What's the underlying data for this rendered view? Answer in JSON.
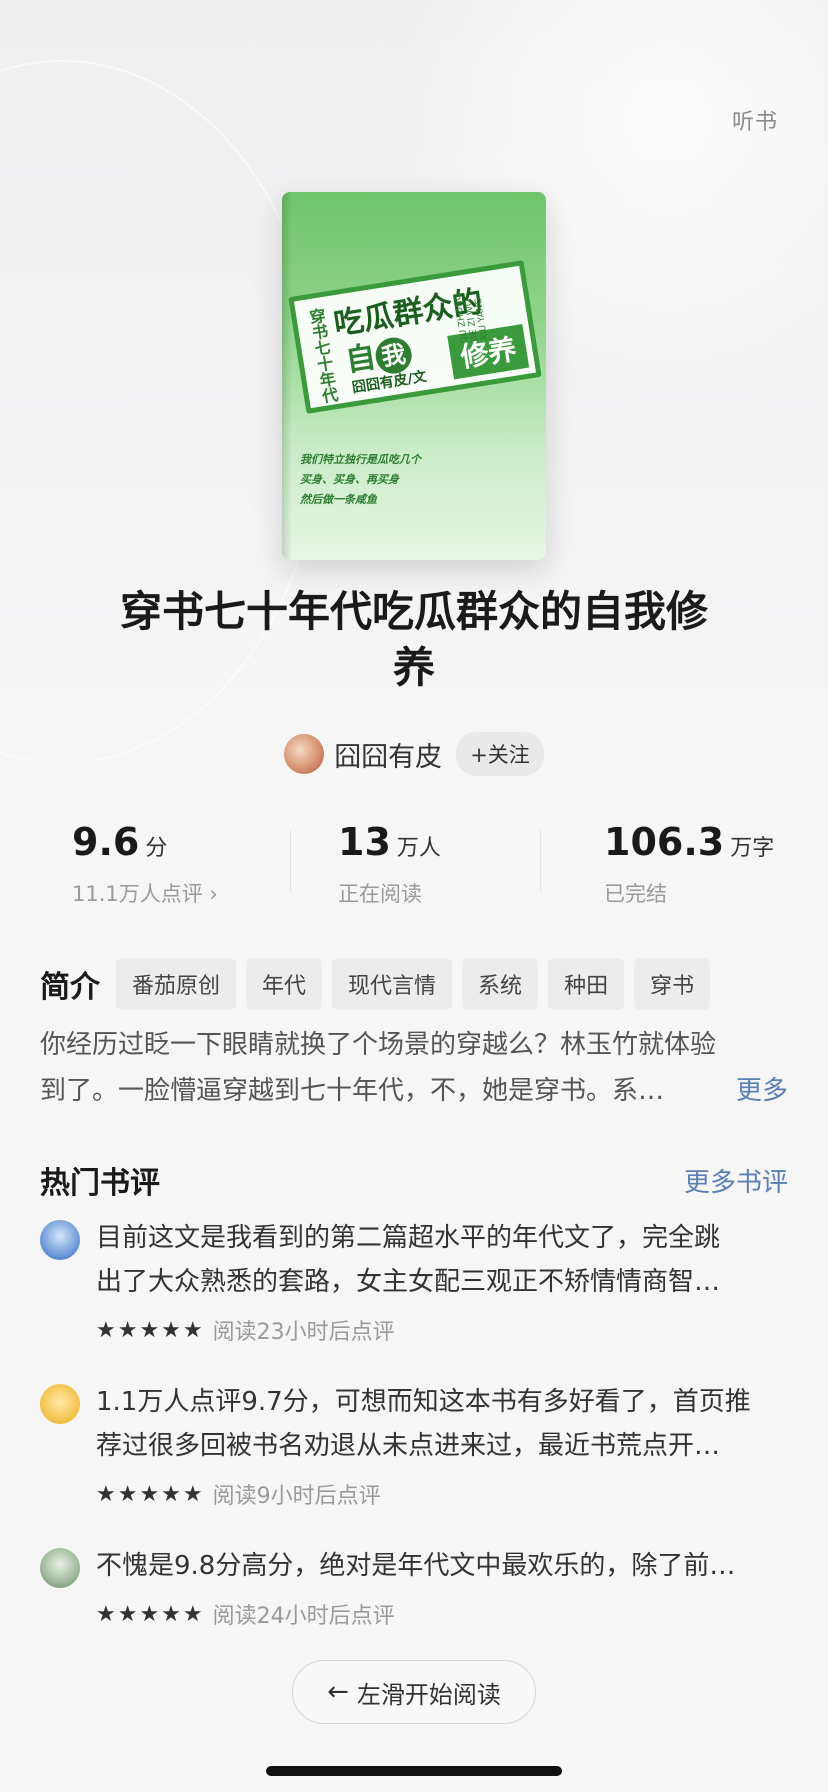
{
  "header": {
    "audio_label": "听书"
  },
  "cover": {
    "side_text": "穿书七十年代",
    "main_line1": "吃瓜群众的",
    "main_line2_a": "自",
    "main_line2_circle": "我",
    "main_line2_box": "修养",
    "author": "囧囧有皮/文",
    "en_text": "QU ZHONG DE ZI WO XIU YANG",
    "slogan": [
      "我们特立独行是瓜吃几个",
      "买身、买身、再买身",
      "然后做一条咸鱼"
    ]
  },
  "book": {
    "title": "穿书七十年代吃瓜群众的自我修养",
    "author": "囧囧有皮",
    "follow_label": "+关注"
  },
  "stats": {
    "rating": {
      "value": "9.6",
      "unit": "分",
      "sub": "11.1万人点评 ›"
    },
    "readers": {
      "value": "13",
      "unit": "万人",
      "sub": "正在阅读"
    },
    "words": {
      "value": "106.3",
      "unit": "万字",
      "sub": "已完结"
    }
  },
  "intro": {
    "label": "简介",
    "tags": [
      "番茄原创",
      "年代",
      "现代言情",
      "系统",
      "种田",
      "穿书"
    ],
    "line1": "你经历过眨一下眼睛就换了个场景的穿越么？林玉竹就体验",
    "line2": "到了。一脸懵逼穿越到七十年代，不，她是穿书。系…",
    "more": "更多"
  },
  "reviews": {
    "title": "热门书评",
    "more": "更多书评",
    "items": [
      {
        "line1": "目前这文是我看到的第二篇超水平的年代文了，完全跳",
        "line2": "出了大众熟悉的套路，女主女配三观正不矫情情商智…",
        "stars": "★★★★★",
        "meta": "阅读23小时后点评"
      },
      {
        "line1": "1.1万人点评9.7分，可想而知这本书有多好看了，首页推",
        "line2": "荐过很多回被书名劝退从未点进来过，最近书荒点开…",
        "stars": "★★★★★",
        "meta": "阅读9小时后点评"
      },
      {
        "line1": "不愧是9.8分高分，绝对是年代文中最欢乐的，除了前…",
        "stars": "★★★★★",
        "meta": "阅读24小时后点评"
      }
    ]
  },
  "start_button": {
    "arrow": "←",
    "label": "左滑开始阅读"
  }
}
